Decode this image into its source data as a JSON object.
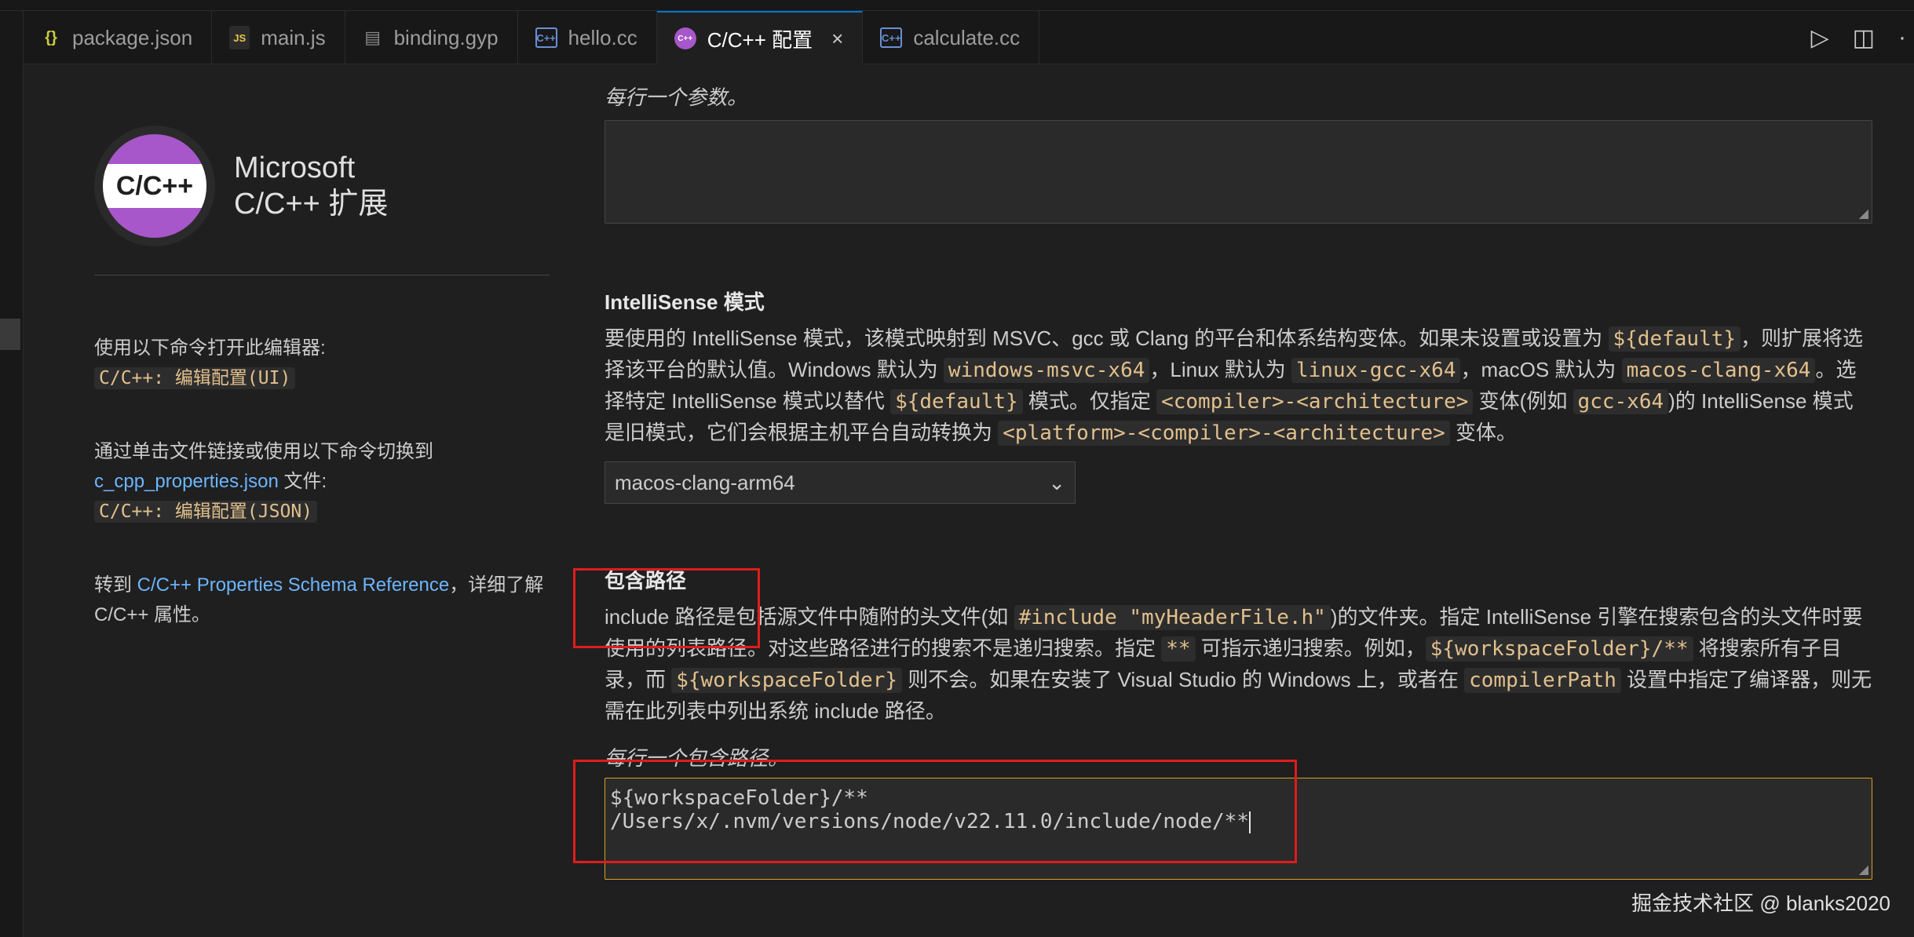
{
  "tabs": [
    {
      "label": "package.json",
      "icon": "json-file-icon",
      "glyph": "{}"
    },
    {
      "label": "main.js",
      "icon": "js-file-icon",
      "glyph": "JS"
    },
    {
      "label": "binding.gyp",
      "icon": "file-icon",
      "glyph": "▤"
    },
    {
      "label": "hello.cc",
      "icon": "cpp-file-icon",
      "glyph": "C++"
    },
    {
      "label": "C/C++ 配置",
      "icon": "cpp-config-icon",
      "glyph": "C++",
      "close": "×"
    },
    {
      "label": "calculate.cc",
      "icon": "cpp-file-icon",
      "glyph": "C++"
    }
  ],
  "tab_actions": {
    "run": "▷",
    "split": "◫",
    "more": "·"
  },
  "brand": {
    "logo_text": "C/C++",
    "line1": "Microsoft",
    "line2": "C/C++ 扩展"
  },
  "left": {
    "open_editor_text": "使用以下命令打开此编辑器:",
    "open_editor_cmd": "C/C++: 编辑配置(UI)",
    "switch_text": "通过单击文件链接或使用以下命令切换到",
    "switch_link": "c_cpp_properties.json",
    "switch_suffix": " 文件:",
    "switch_cmd": "C/C++: 编辑配置(JSON)",
    "ref_prefix": "转到 ",
    "ref_link": "C/C++ Properties Schema Reference",
    "ref_suffix": "，详细了解 C/C++ 属性。"
  },
  "args_section": {
    "hint": "每行一个参数。",
    "value": ""
  },
  "intellisense": {
    "title": "IntelliSense 模式",
    "desc_1": "要使用的 IntelliSense 模式，该模式映射到 MSVC、gcc 或 Clang 的平台和体系结构变体。如果未设置或设置为 ",
    "code_default": "${default}",
    "desc_2": "，则扩展将选择该平台的默认值。Windows 默认为 ",
    "code_win": "windows-msvc-x64",
    "desc_3": "，Linux 默认为 ",
    "code_linux": "linux-gcc-x64",
    "desc_4": "，macOS 默认为 ",
    "code_mac": "macos-clang-x64",
    "desc_5": "。选择特定 IntelliSense 模式以替代 ",
    "code_default2": "${default}",
    "desc_6": " 模式。仅指定 ",
    "code_comp_arch": "<compiler>-<architecture>",
    "desc_7": " 变体(例如 ",
    "code_gcc": "gcc-x64",
    "desc_8": ")的 IntelliSense 模式是旧模式，它们会根据主机平台自动转换为 ",
    "code_plat": "<platform>-<compiler>-<architecture>",
    "desc_9": " 变体。",
    "selected": "macos-clang-arm64",
    "chevron": "⌄"
  },
  "include": {
    "title": "包含路径",
    "desc_1": "include 路径是包括源文件中随附的头文件(如 ",
    "code_include": "#include \"myHeaderFile.h\"",
    "desc_2": ")的文件夹。指定 IntelliSense 引擎在搜索包含的头文件时要使用的列表路径。对这些路径进行的搜索不是递归搜索。指定 ",
    "code_stars": "**",
    "desc_3": " 可指示递归搜索。例如，",
    "code_ws_all": "${workspaceFolder}/**",
    "desc_4": " 将搜索所有子目录，而 ",
    "code_ws": "${workspaceFolder}",
    "desc_5": " 则不会。如果在安装了 Visual Studio 的 Windows 上，或者在 ",
    "code_cp": "compilerPath",
    "desc_6": " 设置中指定了编译器，则无需在此列表中列出系统 include 路径。",
    "hint": "每行一个包含路径。",
    "lines": [
      "${workspaceFolder}/**",
      "/Users/x/.nvm/versions/node/v22.11.0/include/node/**"
    ]
  },
  "watermark": "掘金技术社区 @ blanks2020",
  "colors": {
    "annotation_red": "#e01c1c",
    "accent_blue": "#0078d4",
    "focus_border": "#d9a21b",
    "code_text": "#e2c08d"
  }
}
